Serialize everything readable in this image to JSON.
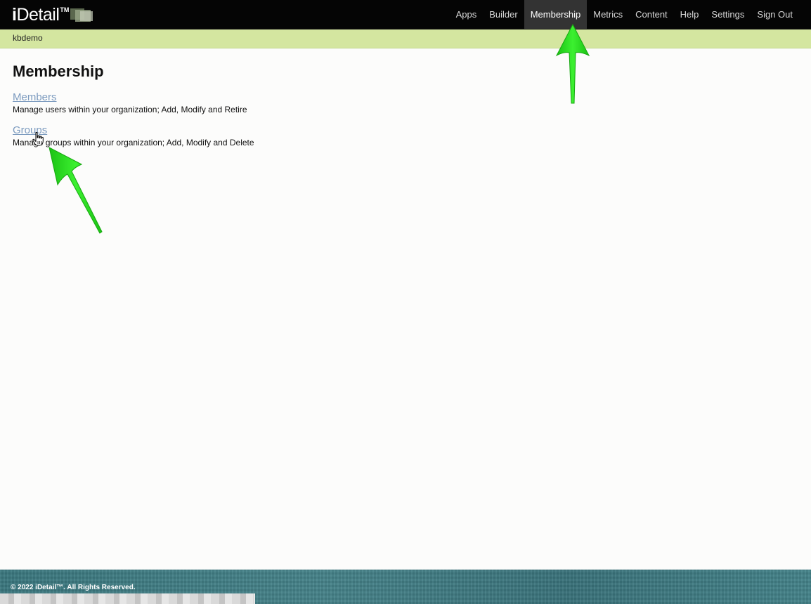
{
  "header": {
    "logo": {
      "prefix": "i",
      "name": "Detail",
      "tm": "TM"
    },
    "nav": [
      {
        "label": "Apps",
        "active": false
      },
      {
        "label": "Builder",
        "active": false
      },
      {
        "label": "Membership",
        "active": true
      },
      {
        "label": "Metrics",
        "active": false
      },
      {
        "label": "Content",
        "active": false
      },
      {
        "label": "Help",
        "active": false
      },
      {
        "label": "Settings",
        "active": false
      },
      {
        "label": "Sign Out",
        "active": false
      }
    ]
  },
  "org_bar": {
    "name": "kbdemo"
  },
  "main": {
    "title": "Membership",
    "sections": [
      {
        "link": "Members",
        "description": "Manage users within your organization; Add, Modify and Retire"
      },
      {
        "link": "Groups",
        "description": "Manage groups within your organization; Add, Modify and Delete"
      }
    ]
  },
  "footer": {
    "copyright": "© 2022 iDetail™.  All Rights Reserved."
  },
  "colors": {
    "topbar": "#050505",
    "org_bar": "#d4e6a0",
    "link": "#7c9bbf",
    "footer": "#3d7a82",
    "annotation_arrow": "#22e01a"
  }
}
